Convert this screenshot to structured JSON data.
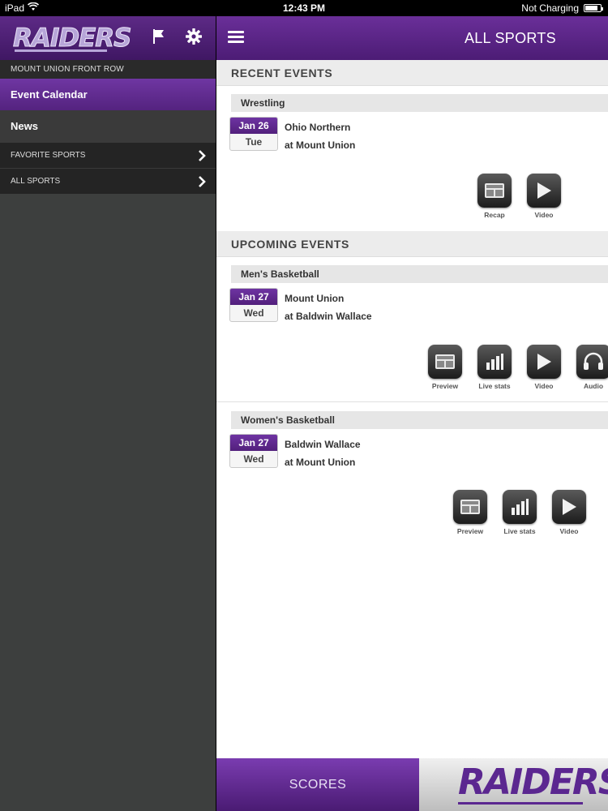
{
  "status_bar": {
    "device": "iPad",
    "time": "12:43 PM",
    "charging": "Not Charging",
    "battery_level": 0.85
  },
  "sidebar": {
    "logo_text": "RAIDERS",
    "section_label": "MOUNT UNION FRONT ROW",
    "items": [
      {
        "label": "Event Calendar",
        "active": true
      },
      {
        "label": "News",
        "active": false
      }
    ],
    "rows": [
      {
        "label": "FAVORITE SPORTS"
      },
      {
        "label": "ALL SPORTS"
      }
    ]
  },
  "header": {
    "title": "ALL SPORTS"
  },
  "recent": {
    "heading": "RECENT EVENTS",
    "events": [
      {
        "sport": "Wrestling",
        "date": "Jan 26",
        "day": "Tue",
        "team1": "Ohio Northern",
        "team2": "at Mount Union",
        "actions": [
          "Recap",
          "Video"
        ]
      }
    ]
  },
  "upcoming": {
    "heading": "UPCOMING EVENTS",
    "events": [
      {
        "sport": "Men's Basketball",
        "date": "Jan 27",
        "day": "Wed",
        "team1": "Mount Union",
        "team2": "at Baldwin Wallace",
        "actions": [
          "Preview",
          "Live stats",
          "Video",
          "Audio"
        ]
      },
      {
        "sport": "Women's Basketball",
        "date": "Jan 27",
        "day": "Wed",
        "team1": "Baldwin Wallace",
        "team2": "at Mount Union",
        "actions": [
          "Preview",
          "Live stats",
          "Video"
        ]
      }
    ]
  },
  "bottom_bar": {
    "scores_label": "SCORES",
    "logo_text": "RAIDERS"
  },
  "colors": {
    "brand_purple": "#5b2790",
    "sidebar_bg": "#3d3f3e"
  }
}
